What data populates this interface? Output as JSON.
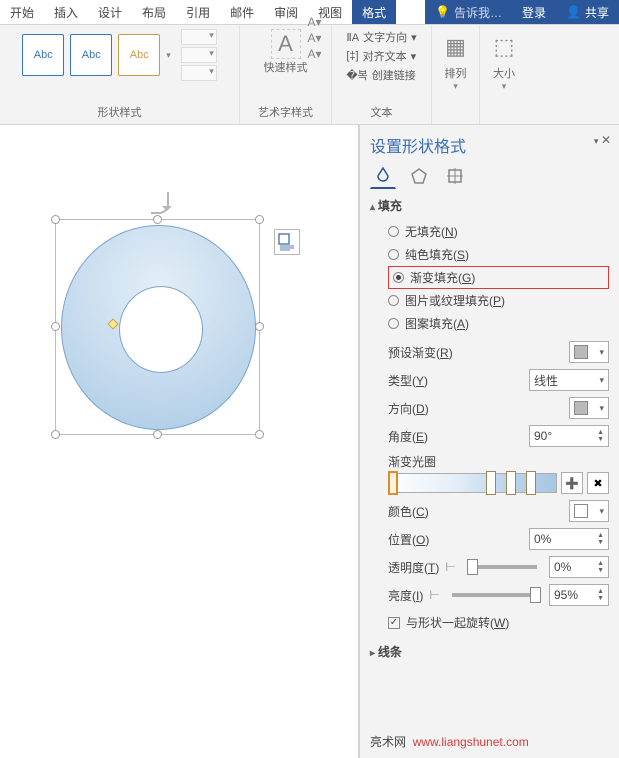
{
  "tabs": {
    "items": [
      "开始",
      "插入",
      "设计",
      "布局",
      "引用",
      "邮件",
      "审阅",
      "视图",
      "格式"
    ],
    "active_index": 8,
    "tell_me": "告诉我…",
    "login": "登录",
    "share": "共享"
  },
  "ribbon": {
    "shape_styles": {
      "label": "形状样式",
      "abc": "Abc"
    },
    "wordart": {
      "label": "艺术字样式",
      "a": "A"
    },
    "quick_styles": "快速样式",
    "text": {
      "direction": "文字方向",
      "align": "对齐文本",
      "link": "创建链接",
      "label": "文本"
    },
    "arrange": "排列",
    "size": "大小"
  },
  "pane": {
    "title": "设置形状格式",
    "sections": {
      "fill": "填充",
      "line": "线条"
    },
    "fill_options": {
      "none": "无填充",
      "none_k": "N",
      "solid": "纯色填充",
      "solid_k": "S",
      "gradient": "渐变填充",
      "gradient_k": "G",
      "picture": "图片或纹理填充",
      "picture_k": "P",
      "pattern": "图案填充",
      "pattern_k": "A",
      "selected": "gradient"
    },
    "fields": {
      "preset": "预设渐变",
      "preset_k": "R",
      "type": "类型",
      "type_k": "Y",
      "type_v": "线性",
      "direction": "方向",
      "direction_k": "D",
      "angle": "角度",
      "angle_k": "E",
      "angle_v": "90°",
      "stops": "渐变光圈",
      "color": "颜色",
      "color_k": "C",
      "position": "位置",
      "position_k": "O",
      "position_v": "0%",
      "transparency": "透明度",
      "transparency_k": "T",
      "transparency_v": "0%",
      "brightness": "亮度",
      "brightness_k": "I",
      "brightness_v": "95%",
      "rotate": "与形状一起旋转",
      "rotate_k": "W"
    }
  },
  "watermark": {
    "a": "亮术网",
    "b": "www.liangshunet.com"
  }
}
